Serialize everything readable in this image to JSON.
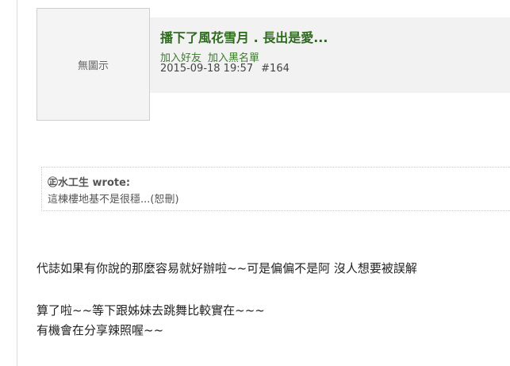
{
  "post": {
    "avatar_text": "無圖示",
    "title": "播下了風花雪月 . 長出是愛...",
    "actions": {
      "add_friend": "加入好友",
      "add_blacklist": "加入黑名單"
    },
    "datetime": "2015-09-18 19:57",
    "post_number": "#164"
  },
  "quote": {
    "author": "㊣水工生 wrote:",
    "text": "這棟樓地基不是很穩...(恕刪)"
  },
  "content": {
    "lines": [
      "代誌如果有你說的那麼容易就好辦啦~~可是偏偏不是阿 沒人想要被誤解",
      "算了啦~~等下跟姊妹去跳舞比較實在~~~",
      "有機會在分享辣照喔~~"
    ]
  },
  "colors": {
    "title": "#2e6b1e",
    "link": "#3c7a2c",
    "header_band": "#f2f2f2"
  }
}
